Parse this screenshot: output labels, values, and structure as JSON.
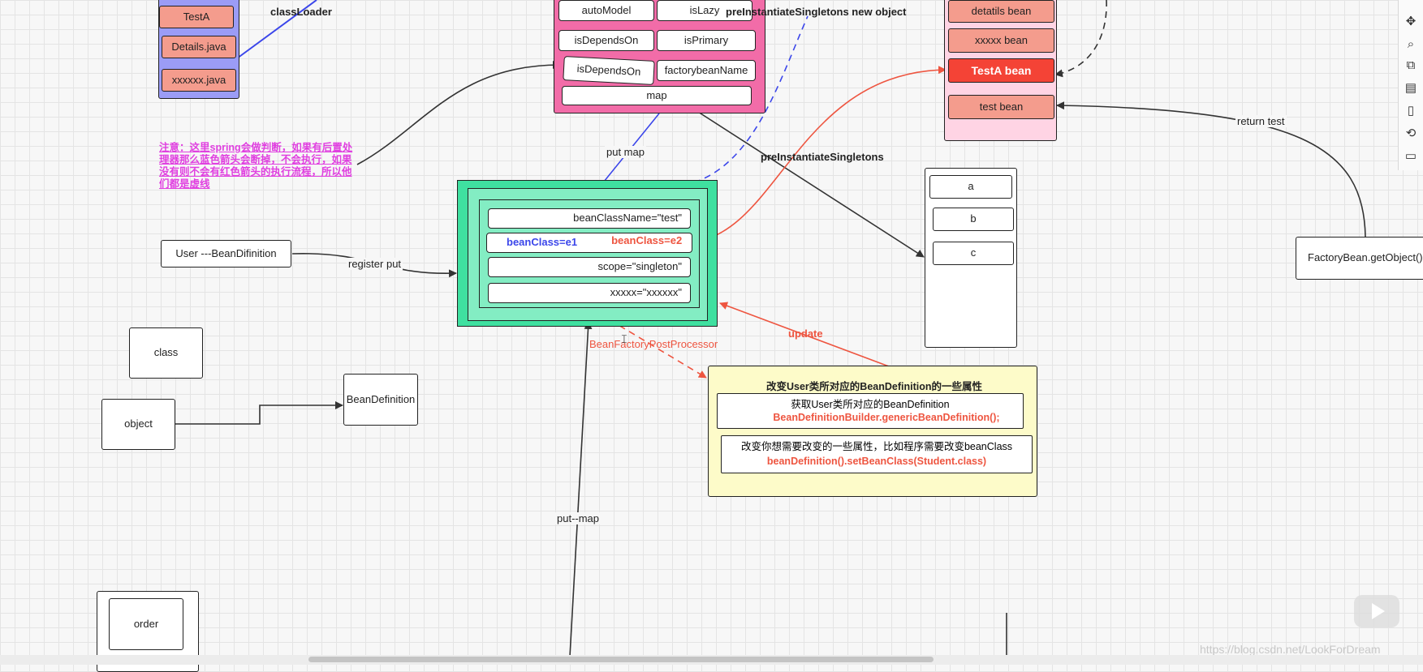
{
  "source_box": {
    "items": [
      "TestA",
      "Details.java",
      "xxxxxx.java"
    ]
  },
  "labels": {
    "class_loader": "classLoader",
    "pre_instantiate_new": "preInstantiateSingletons new object",
    "put_map": "put map",
    "pre_instantiate": "preInstantiateSingletons",
    "register_put": "register put",
    "update": "update",
    "bfpp": "BeanFactoryPostProcessor",
    "put_map2": "put--map",
    "return_test": "return test"
  },
  "note": "注意：这里spring会做判断，如果有后置处理器那么蓝色箭头会断掉，不会执行，如果没有则不会有红色箭头的执行流程，所以他们都是虚线",
  "bean_def_props": {
    "auto_model": "autoModel",
    "is_lazy": "isLazy",
    "is_depends_on": "isDependsOn",
    "is_primary": "isPrimary",
    "is_depends_on_2": "isDependsOn",
    "factory_bean_name": "factorybeanName",
    "map": "map"
  },
  "singleton_pool": {
    "items": [
      "detatils bean",
      "xxxxx bean",
      "TestA bean",
      "test bean"
    ]
  },
  "bean_map": {
    "bean_class_name": "beanClassName=\"test\"",
    "bean_class_e1_key": "beanClass",
    "bean_class_e1_val": "=e1",
    "bean_class_e2": "beanClass=e2",
    "scope": "scope=\"singleton\"",
    "xxxxx": "xxxxx=\"xxxxxx\""
  },
  "abc_box": {
    "items": [
      "a",
      "b",
      "c"
    ]
  },
  "left_nodes": {
    "user_bd": "User ---BeanDifinition",
    "class": "class",
    "object": "object",
    "bean_definition": "BeanDefinition",
    "order": "order"
  },
  "factory_bean": "FactoryBean.getObject()",
  "yellow_box": {
    "title": "改变User类所对应的BeanDefinition的一些属性",
    "row1_text": "获取User类所对应的BeanDefinition",
    "row1_code": "BeanDefinitionBuilder.genericBeanDefinition();",
    "row2_text": "改变你想需要改变的一些属性，比如程序需要改变beanClass",
    "row2_code": "beanDefinition().setBeanClass(Student.class)"
  },
  "watermark": "https://blog.csdn.net/LookForDream_",
  "colors": {
    "source_box_bg": "#9b9cf6",
    "salmon": "#f49c8d",
    "pink_box": "#f26ca8",
    "green_outer": "#3fe0a0",
    "green_inner": "#83edc3",
    "pool_bg": "#ffd4e4",
    "testa_red": "#f44336",
    "yellow": "#fdfbc9",
    "note_magenta": "#e040e0",
    "blue_arrow": "#3b46ea",
    "red_arrow": "#ee5540"
  }
}
